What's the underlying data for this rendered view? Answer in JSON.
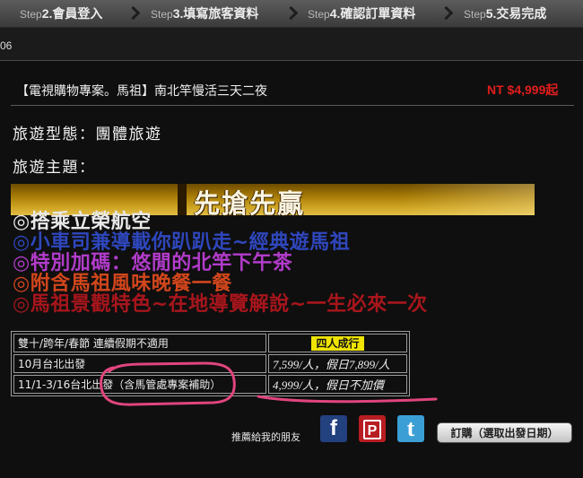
{
  "steps": [
    {
      "prefix": "Step",
      "label": "2.會員登入"
    },
    {
      "prefix": "Step",
      "label": "3.填寫旅客資料"
    },
    {
      "prefix": "Step",
      "label": "4.確認訂單資料"
    },
    {
      "prefix": "Step",
      "label": "5.交易完成"
    }
  ],
  "breadcrumb_fragment": "06",
  "tour": {
    "title": "【電視購物專案。馬祖】南北竿慢活三天二夜",
    "price": "NT $4,999起",
    "type_label": "旅遊型態：團體旅遊",
    "theme_label": "旅遊主題："
  },
  "banner": {
    "text": "先搶先贏"
  },
  "highlights": [
    {
      "text": "◎搭乘立榮航空",
      "color": "#e9e9e9"
    },
    {
      "text": "◎小車司兼導載你趴趴走~經典遊馬祖",
      "color": "#2f47bd"
    },
    {
      "text": "◎特別加碼：悠閒的北竿下午茶",
      "color": "#b23ccb"
    },
    {
      "text": "◎附含馬祖風味晚餐一餐",
      "color": "#d2461c"
    },
    {
      "text": "◎馬祖景觀特色~在地導覽解說~一生必來一次",
      "color": "#a8161c"
    }
  ],
  "price_table": {
    "rows": [
      [
        "雙十/跨年/春節 連續假期不適用",
        "四人成行"
      ],
      [
        "10月台北出發",
        "7,599/人，假日7,899/人"
      ],
      [
        "11/1-3/16台北出發（含馬管處專案補助）",
        "4,999/人，假日不加價"
      ]
    ]
  },
  "share": {
    "label": "推薦給我的朋友",
    "icons": [
      {
        "name": "facebook-icon",
        "glyph": "f",
        "color": "#23407f"
      },
      {
        "name": "plurk-icon",
        "glyph": "P",
        "color": "#b81d22"
      },
      {
        "name": "twitter-icon",
        "glyph": "t",
        "color": "#3b9fd6"
      }
    ]
  },
  "order_button": "訂購（選取出發日期）",
  "colors": {
    "price": "#e21c1c",
    "badge": "#f0e400",
    "annotation": "#e0457e"
  }
}
